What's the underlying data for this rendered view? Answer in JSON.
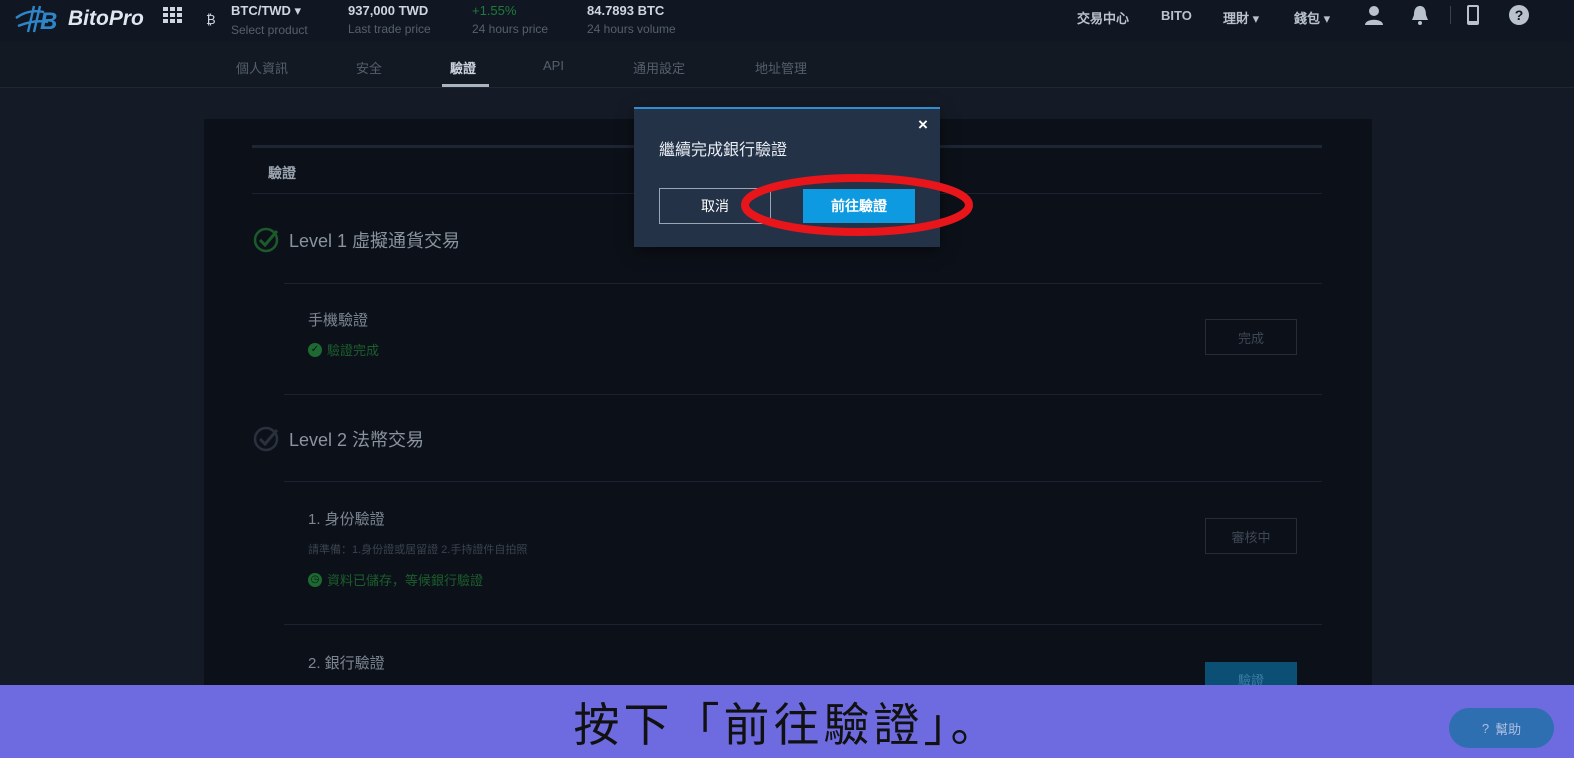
{
  "header": {
    "logo_text": "BitoPro",
    "product": {
      "value": "BTC/TWD ▾",
      "label": "Select product"
    },
    "last_trade": {
      "value": "937,000 TWD",
      "label": "Last trade price"
    },
    "change": {
      "value": "+1.55%",
      "label": "24 hours price"
    },
    "volume": {
      "value": "84.7893 BTC",
      "label": "24 hours volume"
    },
    "nav": {
      "trade_center": "交易中心",
      "bito": "BITO",
      "finance": "理財 ▾",
      "wallet": "錢包 ▾"
    },
    "icons": [
      "grid-icon",
      "user-icon",
      "bell-icon",
      "phone-icon",
      "help-icon"
    ]
  },
  "subnav": {
    "tabs": [
      "個人資訊",
      "安全",
      "驗證",
      "API",
      "通用設定",
      "地址管理"
    ],
    "active": "驗證"
  },
  "verification": {
    "section_title": "驗證",
    "level1": {
      "title": "Level 1 虛擬通貨交易",
      "phone": {
        "title": "手機驗證",
        "status": "驗證完成",
        "button": "完成"
      }
    },
    "level2": {
      "title": "Level 2 法幣交易",
      "identity": {
        "title": "1. 身份驗證",
        "note": "請準備：1.身份證或居留證 2.手持證件自拍照",
        "status": "資料已儲存，等候銀行驗證",
        "button": "審核中"
      },
      "bank": {
        "title": "2. 銀行驗證",
        "button": "驗證"
      }
    }
  },
  "modal": {
    "title": "繼續完成銀行驗證",
    "close": "×",
    "cancel_label": "取消",
    "confirm_label": "前往驗證"
  },
  "help_button": "幫助",
  "caption": "按下「前往驗證」。",
  "colors": {
    "accent": "#0d9ae0",
    "highlight": "#e8151b",
    "caption_bg": "#6e6be0"
  }
}
